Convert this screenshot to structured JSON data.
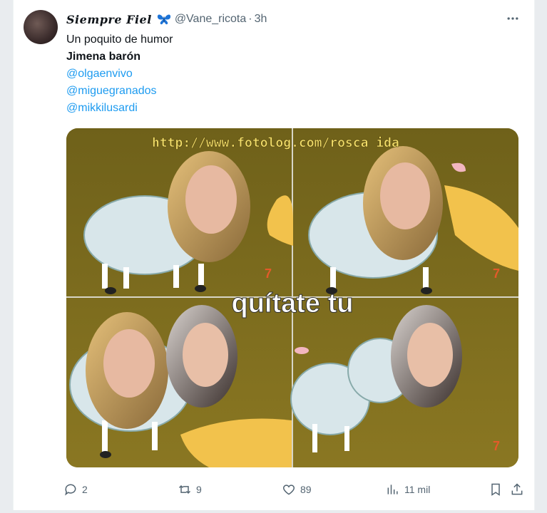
{
  "tweet": {
    "display_name": "Siempre Fiel",
    "handle": "@Vane_ricota",
    "separator": "·",
    "time": "3h",
    "more_icon": "more-horizontal-icon",
    "lines": [
      {
        "text": "Un poquito de humor",
        "style": "normal"
      },
      {
        "text": "Jimena barón",
        "style": "bold"
      },
      {
        "text": "@olgaenvivo",
        "style": "mention"
      },
      {
        "text": "@miguegranados",
        "style": "mention"
      },
      {
        "text": "@mikkilusardi",
        "style": "mention"
      }
    ]
  },
  "media": {
    "watermark": "http://www.fotolog.com/rosca ida",
    "caption": "quítate tu",
    "channel_mark": "7"
  },
  "actions": {
    "reply_count": "2",
    "retweet_count": "9",
    "like_count": "89",
    "views_count": "11 mil"
  },
  "colors": {
    "mention": "#1d9bf0",
    "muted": "#536471",
    "butterfly": "#1d74d8",
    "scene_bg": "#7a6a1a"
  }
}
